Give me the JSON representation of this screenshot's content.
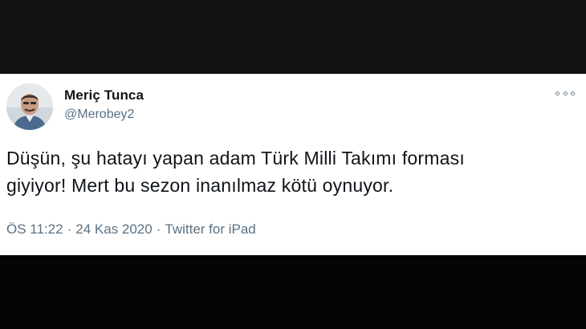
{
  "tweet": {
    "author_name": "Meriç Tunca",
    "author_handle": "@Merobey2",
    "more_icon": "more-horizontal-icon",
    "text_lines": [
      "Düşün, şu hatayı yapan adam Türk Milli Takımı forması",
      "giyiyor! Mert bu sezon inanılmaz kötü oynuyor."
    ],
    "time": "ÖS 11:22",
    "date": "24 Kas 2020",
    "separator": "·",
    "source": "Twitter for iPad"
  },
  "colors": {
    "background_band": "#111111",
    "card": "#ffffff",
    "text_primary": "#0f1419",
    "text_secondary": "#5b7083"
  }
}
